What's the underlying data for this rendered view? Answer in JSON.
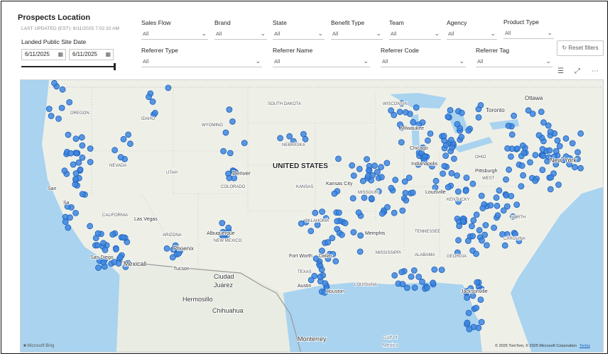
{
  "header": {
    "title": "Prospects Location",
    "last_updated": "LAST UPDATED (EST): 6/11/2025 7:02:32 AM"
  },
  "date_filter": {
    "label": "Landed Public Site Date",
    "start": "6/11/2025",
    "end": "6/11/2025",
    "calendar_icon": "calendar-icon"
  },
  "filters_row1": [
    {
      "label": "Sales Flow",
      "value": "All"
    },
    {
      "label": "Brand",
      "value": "All"
    },
    {
      "label": "State",
      "value": "All"
    },
    {
      "label": "Benefit Type",
      "value": "All"
    },
    {
      "label": "Team",
      "value": "All"
    },
    {
      "label": "Agency",
      "value": "All"
    },
    {
      "label": "Product Type",
      "value": "All"
    }
  ],
  "filters_row2": [
    {
      "label": "Referrer Type",
      "value": "All"
    },
    {
      "label": "Referrer Name",
      "value": "All"
    },
    {
      "label": "Referrer Code",
      "value": "All"
    },
    {
      "label": "Referrer Tag",
      "value": "All"
    }
  ],
  "reset_button": {
    "label": "Reset filters",
    "icon": "reset-icon"
  },
  "visual_icons": [
    "filter-icon",
    "focus-mode-icon",
    "more-options-icon"
  ],
  "map": {
    "marker_color": "#3d86e0",
    "marker_stroke": "#1c5fb8",
    "labels": {
      "country": "UNITED STATES",
      "south_dakota": "SOUTH DAKOTA",
      "oregon": "OREGON",
      "idaho": "IDAHO",
      "wyoming": "WYOMING",
      "nebraska": "NEBRASKA",
      "nevada": "NEVADA",
      "utah": "UTAH",
      "colorado": "COLORADO",
      "kansas": "KANSAS",
      "missouri": "MISSOURI",
      "california": "CALIFORNIA",
      "arizona": "ARIZONA",
      "new_mexico": "NEW MEXICO",
      "oklahoma": "OKLAHOMA",
      "texas": "TEXAS",
      "west_virginia": "WEST",
      "kentucky": "KENTUCKY",
      "north_carolina": "NORTH",
      "south_carolina": "CAROLINA",
      "wisconsin": "WISCONSIN",
      "ohio": "OHIO",
      "indiana": "Indianapolis",
      "tennessee": "TENNESSEE",
      "alabama": "ALABAMA",
      "georgia": "GEORGIA",
      "mississippi": "MISSISSIPPI",
      "louisiana": "LOUISIANA",
      "denver": "Denver",
      "las_vegas": "Las Vegas",
      "phoenix": "Phoenix",
      "tucson": "Tucson",
      "albuquerque": "Albuquerque",
      "san_diego": "San Diego",
      "mexicali": "Mexicali",
      "ciudad_juarez_1": "Ciudad",
      "ciudad_juarez_2": "Juárez",
      "hermosillo": "Hermosillo",
      "chihuahua": "Chihuahua",
      "monterrey": "Monterrey",
      "fort_worth": "Fort Worth",
      "dallas": "Dallas",
      "austin": "Austin",
      "houston": "Houston",
      "memphis": "Memphis",
      "kansas_city": "Kansas City",
      "toronto": "Toronto",
      "ottawa": "Ottawa",
      "new_york": "New York",
      "chicago": "Chicago",
      "milwaukee": "Milwaukee",
      "pittsburgh": "Pittsburgh",
      "louisville": "Louisville",
      "jacksonville": "Jacksonville",
      "gulf_1": "Gulf of",
      "gulf_2": "Mexico",
      "sf": "San",
      "ca_coast": "Sa"
    },
    "bing_label": "Microsoft Bing",
    "credits": "© 2025 TomTom, © 2025 Microsoft Corporation",
    "terms": "Terms"
  }
}
